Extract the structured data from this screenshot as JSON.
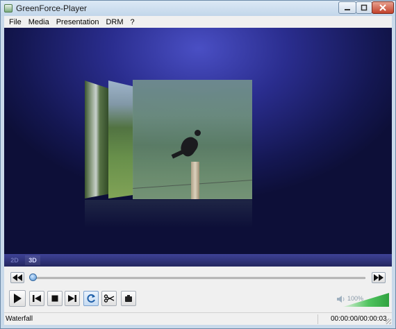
{
  "window": {
    "title": "GreenForce-Player"
  },
  "menu": {
    "items": [
      "File",
      "Media",
      "Presentation",
      "DRM",
      "?"
    ]
  },
  "view_modes": {
    "mode_2d": "2D",
    "mode_3d": "3D",
    "active": "3D"
  },
  "playback": {
    "progress": 0.0,
    "volume_label": "100%",
    "volume": 1.0
  },
  "status": {
    "current_item": "Waterfall",
    "time": "00:00:00/00:00:03"
  },
  "icons": {
    "rewind": "rewind-icon",
    "forward": "fast-forward-icon",
    "play": "play-icon",
    "prev": "previous-icon",
    "stop": "stop-icon",
    "next": "next-icon",
    "repeat": "repeat-icon",
    "cut": "scissors-icon",
    "snapshot": "snapshot-icon",
    "speaker": "speaker-icon"
  },
  "colors": {
    "accent": "#4f8fd1",
    "video_bg": "#2a2d8e",
    "volume": "#3fbf4f"
  }
}
